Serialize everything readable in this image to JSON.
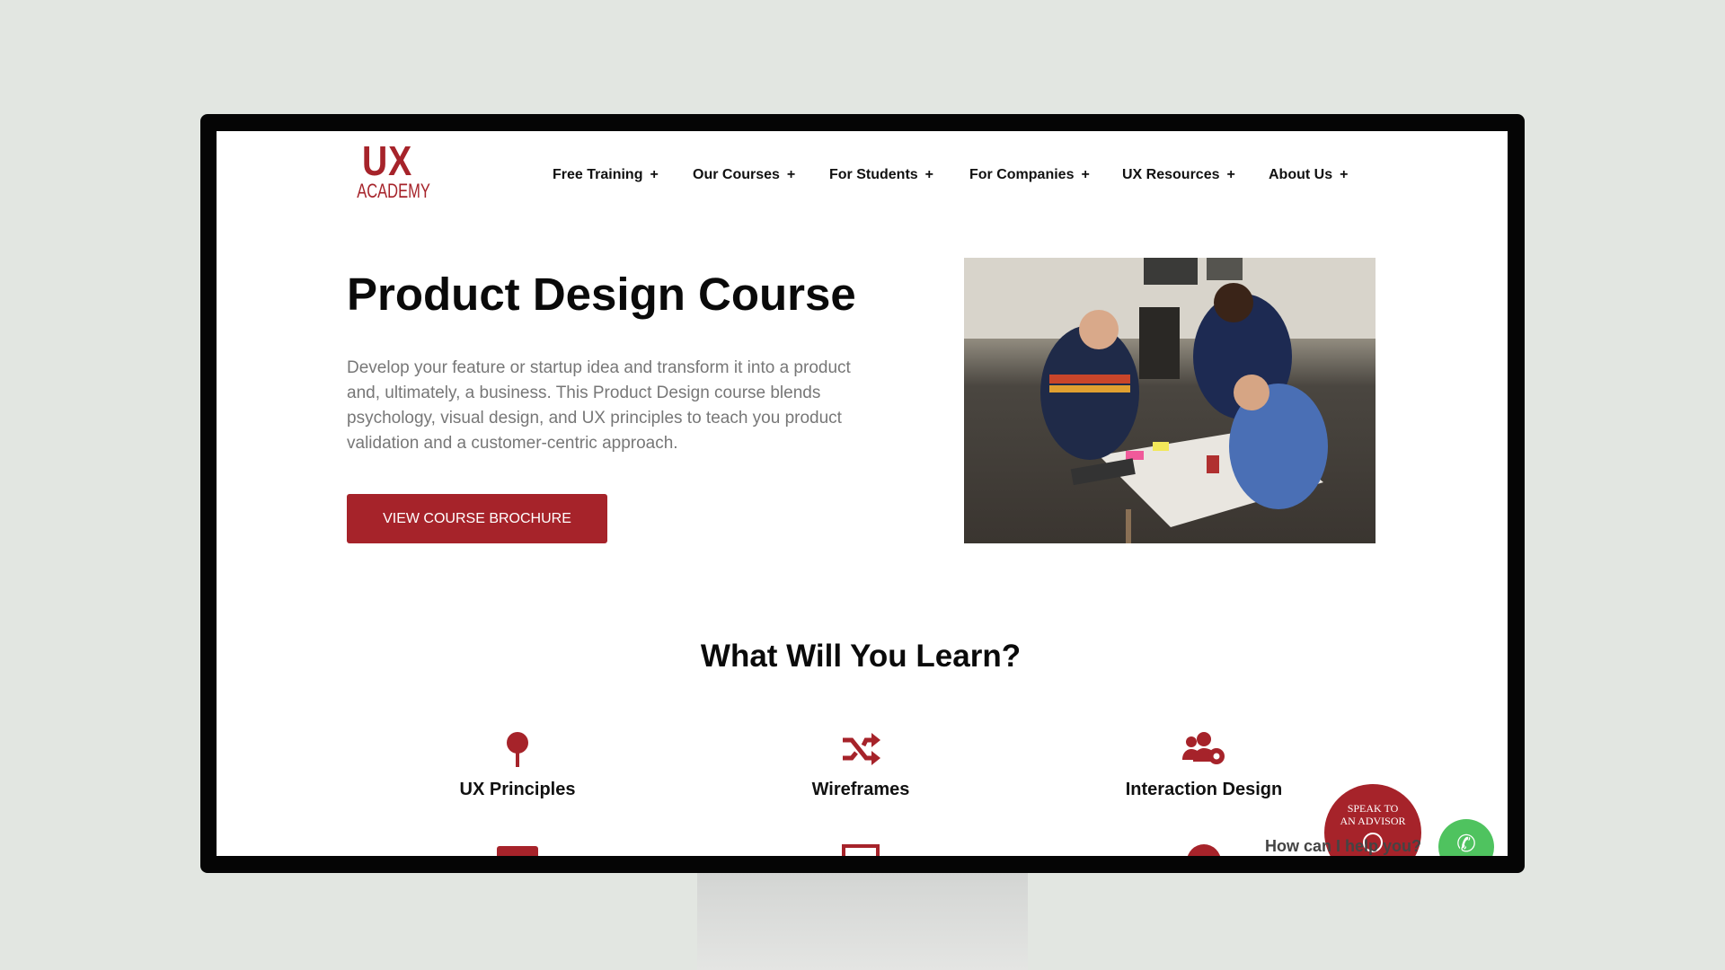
{
  "logo": {
    "line1": "UX",
    "line2": "ACADEMY"
  },
  "nav": [
    {
      "label": "Free Training",
      "icon": "+"
    },
    {
      "label": "Our Courses",
      "icon": "+"
    },
    {
      "label": "For Students",
      "icon": "+"
    },
    {
      "label": "For Companies",
      "icon": "+"
    },
    {
      "label": "UX Resources",
      "icon": "+"
    },
    {
      "label": "About Us",
      "icon": "+"
    }
  ],
  "hero": {
    "title": "Product Design Course",
    "description": "Develop your feature or startup idea and transform it into a product and, ultimately, a business. This Product Design course blends psychology, visual design, and UX principles to teach you product validation and a customer-centric approach.",
    "cta": "VIEW COURSE BROCHURE"
  },
  "learn": {
    "title": "What Will You Learn?",
    "items": [
      {
        "label": "UX Principles",
        "icon": "pin-icon"
      },
      {
        "label": "Wireframes",
        "icon": "shuffle-icon"
      },
      {
        "label": "Interaction Design",
        "icon": "users-cog-icon"
      }
    ]
  },
  "chat": {
    "advisor_line1": "SPEAK TO",
    "advisor_line2": "AN ADVISOR",
    "help": "How can I help you?"
  },
  "colors": {
    "brand": "#a6232a",
    "whatsapp": "#4fc35f"
  }
}
